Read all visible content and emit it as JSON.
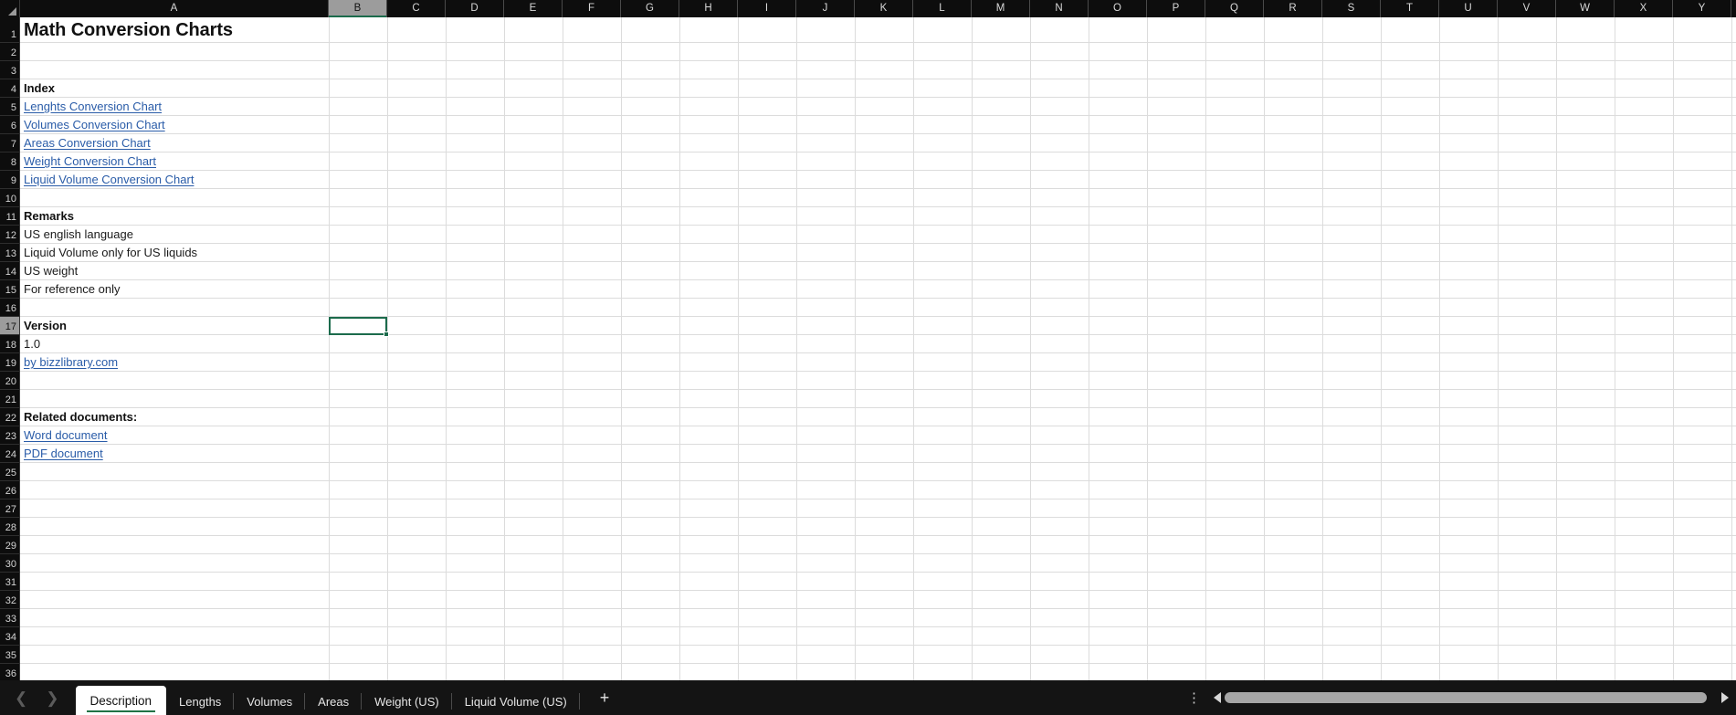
{
  "app": {
    "type": "spreadsheet",
    "accent_color": "#217346",
    "link_color": "#2a5ca8",
    "selected_cell": "B17"
  },
  "grid": {
    "corner_label": "select-all",
    "columns": [
      "A",
      "B",
      "C",
      "D",
      "E",
      "F",
      "G",
      "H",
      "I",
      "J",
      "K",
      "L",
      "M",
      "N",
      "O",
      "P",
      "Q",
      "R",
      "S",
      "T",
      "U",
      "V",
      "W",
      "X",
      "Y"
    ],
    "active_column": "B",
    "active_row": 17,
    "row_count": 36,
    "rows": [
      {
        "n": 1,
        "text": "Math Conversion Charts",
        "style": "title"
      },
      {
        "n": 2,
        "text": "",
        "style": "plain"
      },
      {
        "n": 3,
        "text": "",
        "style": "plain"
      },
      {
        "n": 4,
        "text": "Index",
        "style": "bold"
      },
      {
        "n": 5,
        "text": "Lenghts Conversion Chart",
        "style": "link"
      },
      {
        "n": 6,
        "text": "Volumes Conversion Chart",
        "style": "link"
      },
      {
        "n": 7,
        "text": "Areas Conversion Chart",
        "style": "link"
      },
      {
        "n": 8,
        "text": "Weight Conversion Chart",
        "style": "link"
      },
      {
        "n": 9,
        "text": "Liquid Volume Conversion Chart",
        "style": "link"
      },
      {
        "n": 10,
        "text": "",
        "style": "plain"
      },
      {
        "n": 11,
        "text": "Remarks",
        "style": "bold"
      },
      {
        "n": 12,
        "text": "US english language",
        "style": "plain"
      },
      {
        "n": 13,
        "text": "Liquid Volume only for US liquids",
        "style": "plain"
      },
      {
        "n": 14,
        "text": "US weight",
        "style": "plain"
      },
      {
        "n": 15,
        "text": "For reference only",
        "style": "plain"
      },
      {
        "n": 16,
        "text": "",
        "style": "plain"
      },
      {
        "n": 17,
        "text": "Version",
        "style": "bold"
      },
      {
        "n": 18,
        "text": "1.0",
        "style": "plain"
      },
      {
        "n": 19,
        "text": "by bizzlibrary.com",
        "style": "link"
      },
      {
        "n": 20,
        "text": "",
        "style": "plain"
      },
      {
        "n": 21,
        "text": "",
        "style": "plain"
      },
      {
        "n": 22,
        "text": "Related documents:",
        "style": "bold"
      },
      {
        "n": 23,
        "text": "Word document",
        "style": "link"
      },
      {
        "n": 24,
        "text": "PDF document",
        "style": "link"
      },
      {
        "n": 25,
        "text": "",
        "style": "plain"
      },
      {
        "n": 26,
        "text": "",
        "style": "plain"
      },
      {
        "n": 27,
        "text": "",
        "style": "plain"
      },
      {
        "n": 28,
        "text": "",
        "style": "plain"
      },
      {
        "n": 29,
        "text": "",
        "style": "plain"
      },
      {
        "n": 30,
        "text": "",
        "style": "plain"
      },
      {
        "n": 31,
        "text": "",
        "style": "plain"
      },
      {
        "n": 32,
        "text": "",
        "style": "plain"
      },
      {
        "n": 33,
        "text": "",
        "style": "plain"
      },
      {
        "n": 34,
        "text": "",
        "style": "plain"
      },
      {
        "n": 35,
        "text": "",
        "style": "plain"
      },
      {
        "n": 36,
        "text": "",
        "style": "plain"
      }
    ]
  },
  "bottom_bar": {
    "prev_sheet_icon": "chevron-left-icon",
    "next_sheet_icon": "chevron-right-icon",
    "tabs": [
      {
        "label": "Description",
        "active": true
      },
      {
        "label": "Lengths",
        "active": false
      },
      {
        "label": "Volumes",
        "active": false
      },
      {
        "label": "Areas",
        "active": false
      },
      {
        "label": "Weight (US)",
        "active": false
      },
      {
        "label": "Liquid Volume (US)",
        "active": false
      }
    ],
    "add_sheet_label": "+",
    "kebab_label": "⋮",
    "scroll_left_icon": "triangle-left-icon",
    "scroll_right_icon": "triangle-right-icon"
  }
}
